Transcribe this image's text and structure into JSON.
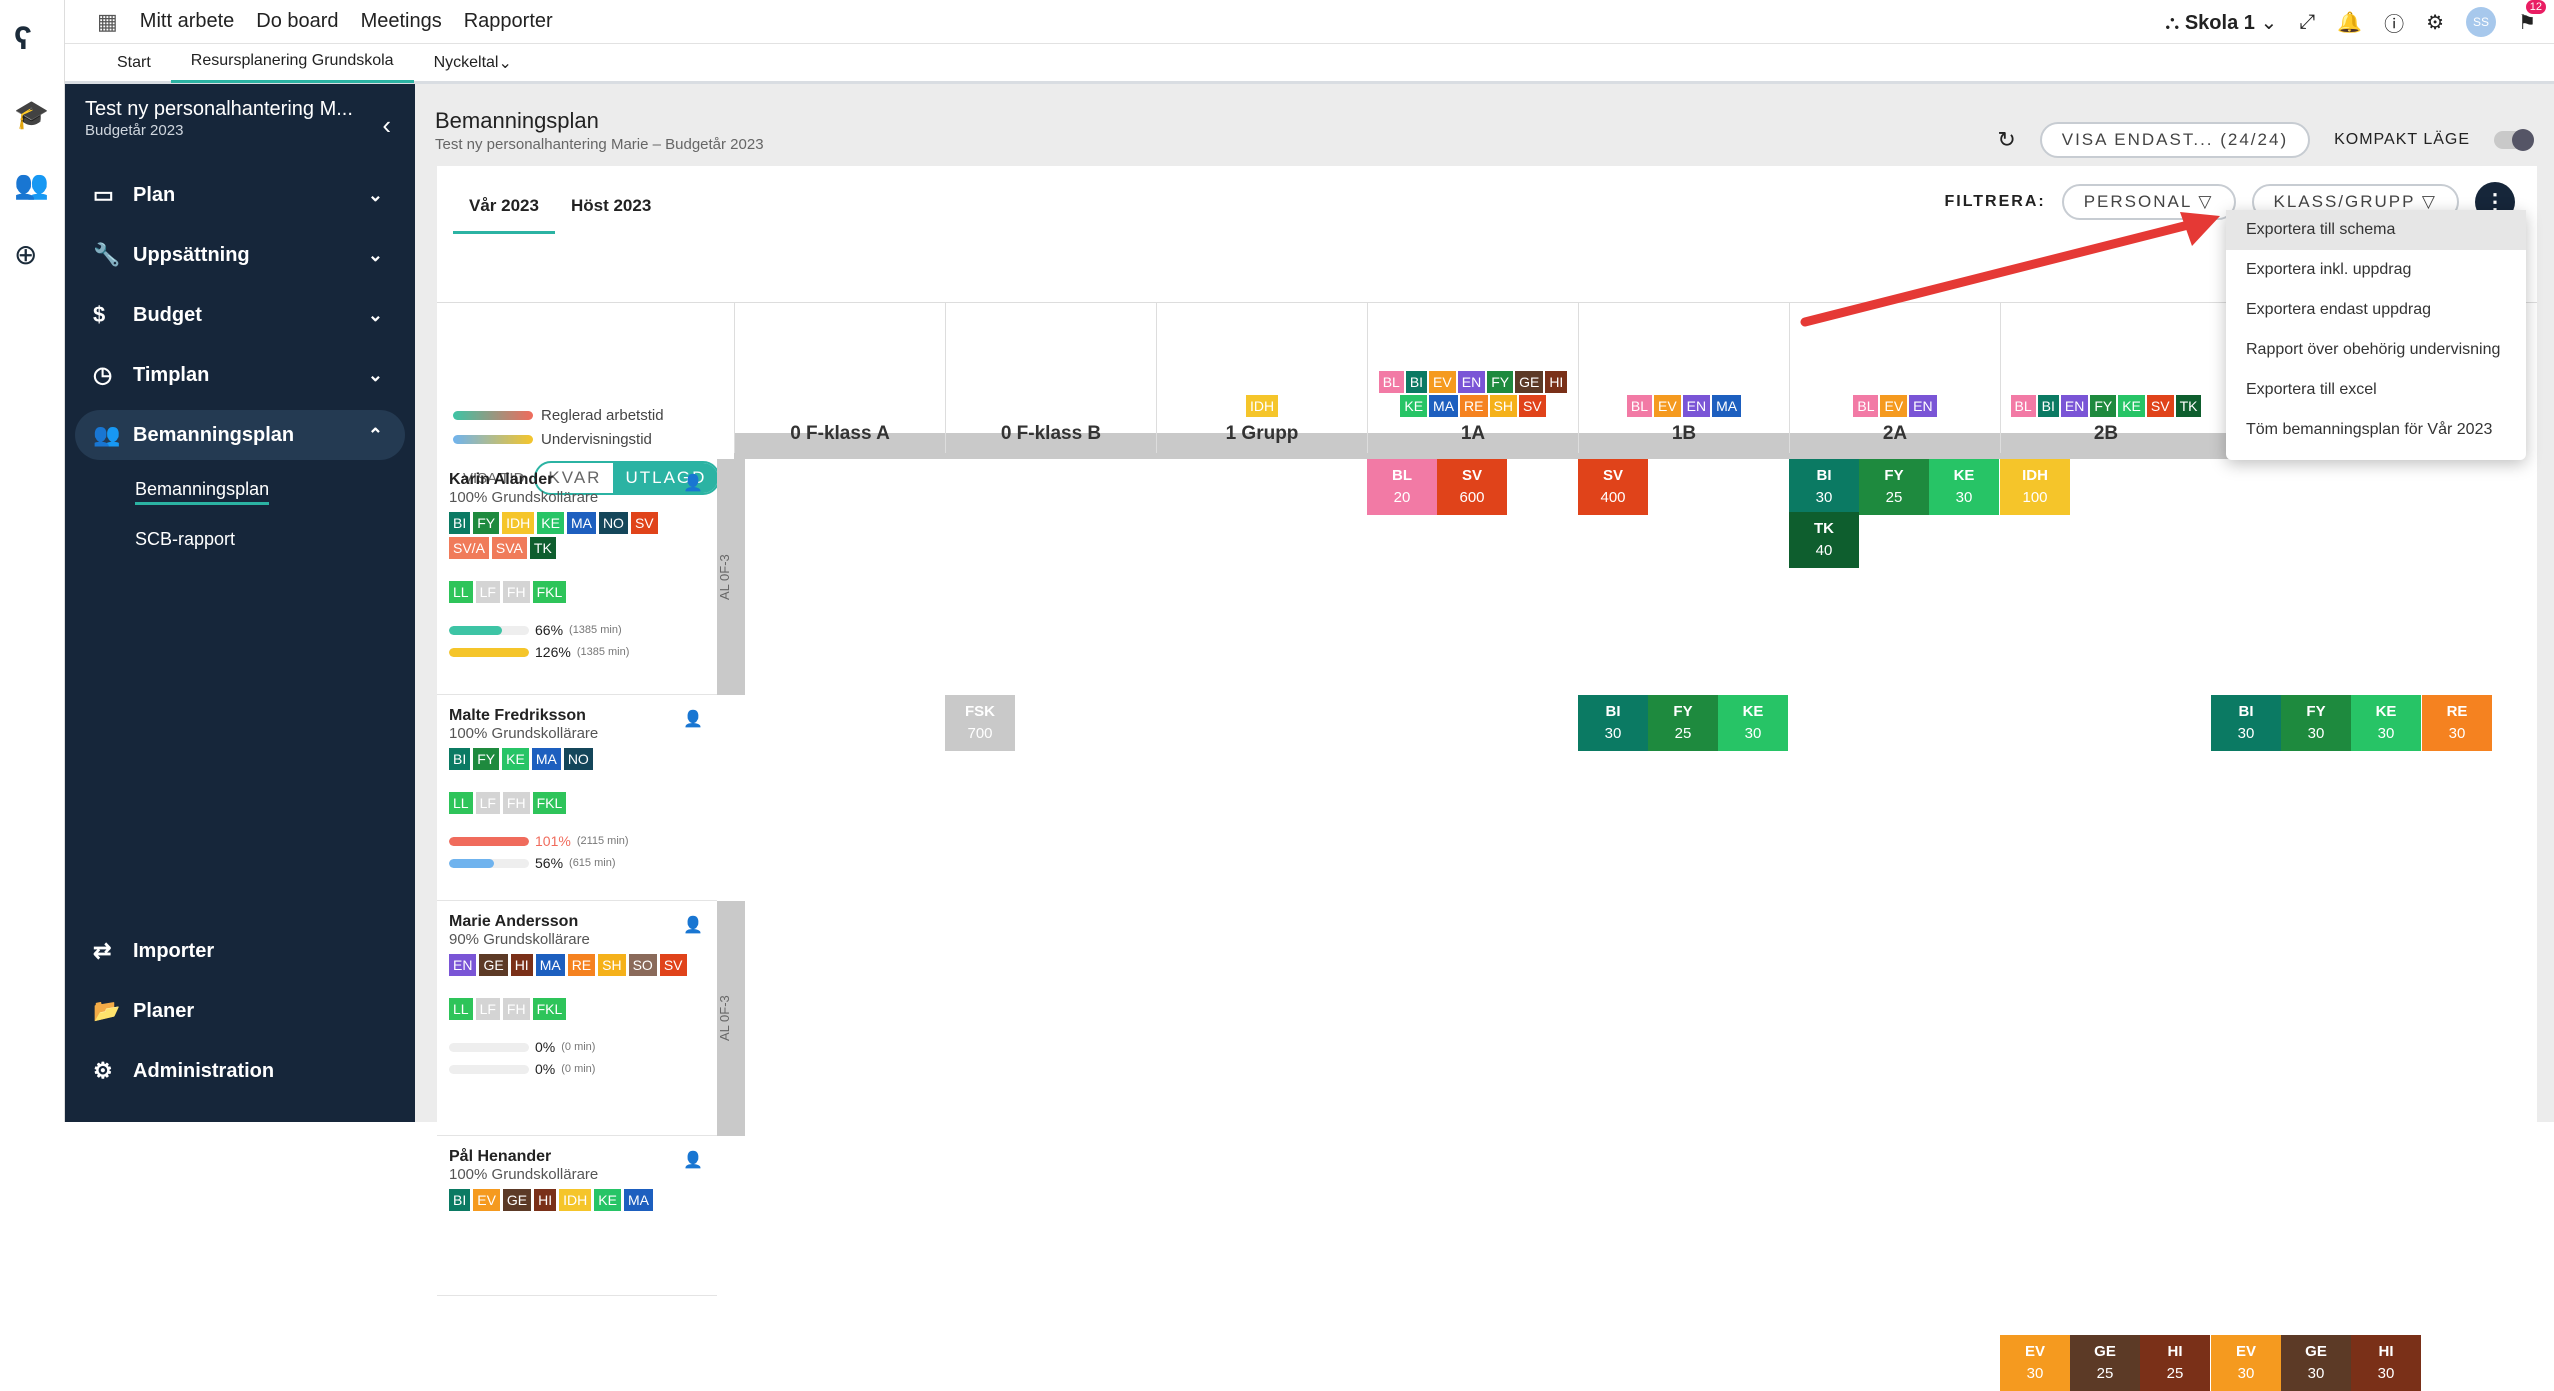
{
  "topnav": {
    "items": [
      "Mitt arbete",
      "Do board",
      "Meetings",
      "Rapporter"
    ],
    "school": "Skola 1",
    "avatar": "SS",
    "notif_count": "12"
  },
  "subnav": {
    "items": [
      "Start",
      "Resursplanering Grundskola",
      "Nyckeltal"
    ]
  },
  "sidebar": {
    "title": "Test ny personalhantering M...",
    "subtitle": "Budgetår 2023",
    "items": [
      "Plan",
      "Uppsättning",
      "Budget",
      "Timplan",
      "Bemanningsplan"
    ],
    "sub": [
      "Bemanningsplan",
      "SCB-rapport"
    ],
    "bottom": [
      "Importer",
      "Planer",
      "Administration"
    ]
  },
  "page": {
    "title": "Bemanningsplan",
    "subtitle": "Test ny personalhantering Marie – Budgetår 2023",
    "visa_endast": "VISA ENDAST... (24/24)",
    "kompakt": "KOMPAKT LÄGE"
  },
  "tabs": [
    "Vår 2023",
    "Höst 2023"
  ],
  "filter": {
    "label": "FILTRERA:",
    "personal": "PERSONAL",
    "klass": "KLASS/GRUPP"
  },
  "legend": {
    "reg": "Reglerad arbetstid",
    "und": "Undervisningstid",
    "visa": "VISA TID",
    "kvar": "KVAR",
    "utlagd": "UTLAGD"
  },
  "columns": [
    {
      "name": "0 F-klass A",
      "tags": []
    },
    {
      "name": "0 F-klass B",
      "tags": []
    },
    {
      "name": "1 Grupp",
      "tags": [
        "IDH"
      ]
    },
    {
      "name": "1A",
      "tags": [
        "BL",
        "BI",
        "EV",
        "EN",
        "FY",
        "GE",
        "HI",
        "KE",
        "MA",
        "RE",
        "SH",
        "SV"
      ]
    },
    {
      "name": "1B",
      "tags": [
        "BL",
        "EV",
        "EN",
        "MA"
      ]
    },
    {
      "name": "2A",
      "tags": [
        "BL",
        "EV",
        "EN"
      ]
    },
    {
      "name": "2B",
      "tags": [
        "BL",
        "BI",
        "EN",
        "FY",
        "KE",
        "SV",
        "TK"
      ]
    }
  ],
  "persons": [
    {
      "name": "Karin Alander",
      "role": "100% Grundskollärare",
      "subjects": [
        "BI",
        "FY",
        "IDH",
        "KE",
        "MA",
        "NO",
        "SV",
        "SV/A",
        "SVA",
        "TK"
      ],
      "lic": [
        "LL",
        "LF",
        "FH",
        "FKL"
      ],
      "p1": "66%",
      "p1m": "(1385 min)",
      "p2": "126%",
      "p2m": "(1385 min)",
      "group": "AL 0F-3"
    },
    {
      "name": "Malte Fredriksson",
      "role": "100% Grundskollärare",
      "subjects": [
        "BI",
        "FY",
        "KE",
        "MA",
        "NO"
      ],
      "lic": [
        "LL",
        "LF",
        "FH",
        "FKL"
      ],
      "p1": "101%",
      "p1m": "(2115 min)",
      "p2": "56%",
      "p2m": "(615 min)"
    },
    {
      "name": "Marie Andersson",
      "role": "90% Grundskollärare",
      "subjects": [
        "EN",
        "GE",
        "HI",
        "MA",
        "RE",
        "SH",
        "SO",
        "SV"
      ],
      "lic": [
        "LL",
        "LF",
        "FH",
        "FKL"
      ],
      "p1": "0%",
      "p1m": "(0 min)",
      "p2": "0%",
      "p2m": "(0 min)",
      "group": "AL 0F-3"
    },
    {
      "name": "Pål Henander",
      "role": "100% Grundskollärare",
      "subjects": [
        "BI",
        "EV",
        "GE",
        "HI",
        "IDH",
        "KE",
        "MA"
      ]
    }
  ],
  "cells": [
    {
      "s": "BL",
      "v": "20"
    },
    {
      "s": "SV",
      "v": "600"
    },
    {
      "s": "SV",
      "v": "400"
    },
    {
      "s": "BI",
      "v": "30"
    },
    {
      "s": "FY",
      "v": "25"
    },
    {
      "s": "KE",
      "v": "30"
    },
    {
      "s": "IDH",
      "v": "100"
    },
    {
      "s": "TK",
      "v": "40"
    },
    {
      "s": "FSK",
      "v": "700"
    },
    {
      "s": "BI",
      "v": "30"
    },
    {
      "s": "FY",
      "v": "25"
    },
    {
      "s": "KE",
      "v": "30"
    },
    {
      "s": "BI",
      "v": "30"
    },
    {
      "s": "FY",
      "v": "30"
    },
    {
      "s": "KE",
      "v": "30"
    },
    {
      "s": "RE",
      "v": "30"
    },
    {
      "s": "EV",
      "v": "30"
    },
    {
      "s": "GE",
      "v": "25"
    },
    {
      "s": "HI",
      "v": "25"
    },
    {
      "s": "EV",
      "v": "30"
    },
    {
      "s": "GE",
      "v": "30"
    },
    {
      "s": "HI",
      "v": "30"
    }
  ],
  "menu": [
    "Exportera till schema",
    "Exportera inkl. uppdrag",
    "Exportera endast uppdrag",
    "Rapport över obehörig undervisning",
    "Exportera till excel",
    "Töm bemanningsplan för Vår 2023"
  ],
  "colors": {
    "BL": "#f27aa5",
    "BI": "#0b7a63",
    "EV": "#f59a1f",
    "EN": "#7a55d6",
    "FY": "#1e8a3e",
    "GE": "#5c3a26",
    "HI": "#7a3018",
    "KE": "#27c466",
    "MA": "#1d5fbf",
    "RE": "#f58220",
    "SH": "#f5b11a",
    "SV": "#e0431a",
    "IDH": "#f5c52a",
    "TK": "#0e5e2e",
    "NO": "#14465a",
    "SO": "#8a6a5a",
    "SV/A": "#f07b5a",
    "SVA": "#f07b5a",
    "FSK": "#c9c9c9",
    "LL": "#2ec45a",
    "LF": "#d4d4d4",
    "FH": "#d4d4d4",
    "FKL": "#2ec45a"
  }
}
